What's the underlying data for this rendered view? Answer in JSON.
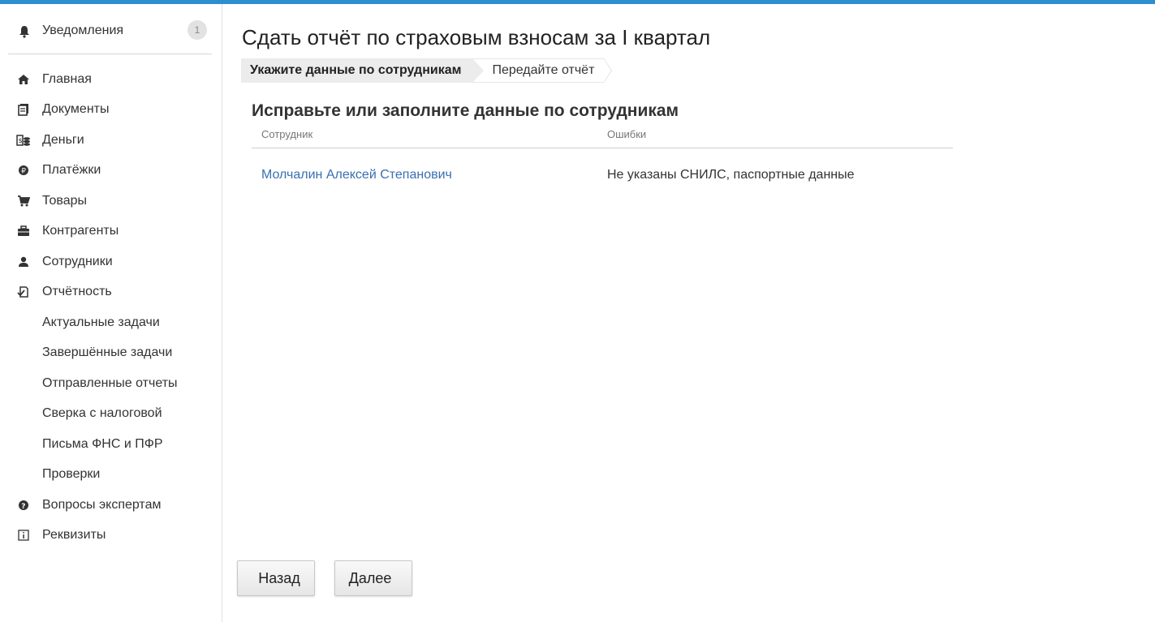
{
  "sidebar": {
    "notifications": {
      "label": "Уведомления",
      "count": "1",
      "icon": "bell-icon"
    },
    "items": [
      {
        "label": "Главная",
        "icon": "home-icon"
      },
      {
        "label": "Документы",
        "icon": "documents-icon"
      },
      {
        "label": "Деньги",
        "icon": "money-icon"
      },
      {
        "label": "Платёжки",
        "icon": "payments-icon"
      },
      {
        "label": "Товары",
        "icon": "cart-icon"
      },
      {
        "label": "Контрагенты",
        "icon": "briefcase-icon"
      },
      {
        "label": "Сотрудники",
        "icon": "user-icon"
      },
      {
        "label": "Отчётность",
        "icon": "reports-icon"
      }
    ],
    "reports_sub": [
      "Актуальные задачи",
      "Завершённые задачи",
      "Отправленные отчеты",
      "Сверка с налоговой",
      "Письма ФНС и ПФР",
      "Проверки"
    ],
    "bottom_items": [
      {
        "label": "Вопросы экспертам",
        "icon": "question-icon"
      },
      {
        "label": "Реквизиты",
        "icon": "info-icon"
      }
    ]
  },
  "main": {
    "title": "Сдать отчёт по страховым взносам за I квартал",
    "steps": [
      "Укажите данные по сотрудникам",
      "Передайте отчёт"
    ],
    "section_title": "Исправьте или заполните данные по сотрудникам",
    "table": {
      "headers": [
        "Сотрудник",
        "Ошибки"
      ],
      "rows": [
        {
          "employee": "Молчалин Алексей Степанович",
          "errors": "Не указаны СНИЛС, паспортные данные"
        }
      ]
    },
    "buttons": {
      "back": "Назад",
      "next": "Далее"
    }
  },
  "colors": {
    "accent": "#2e8fd0",
    "link": "#3a6fb0",
    "step_active_bg": "#ececec"
  }
}
